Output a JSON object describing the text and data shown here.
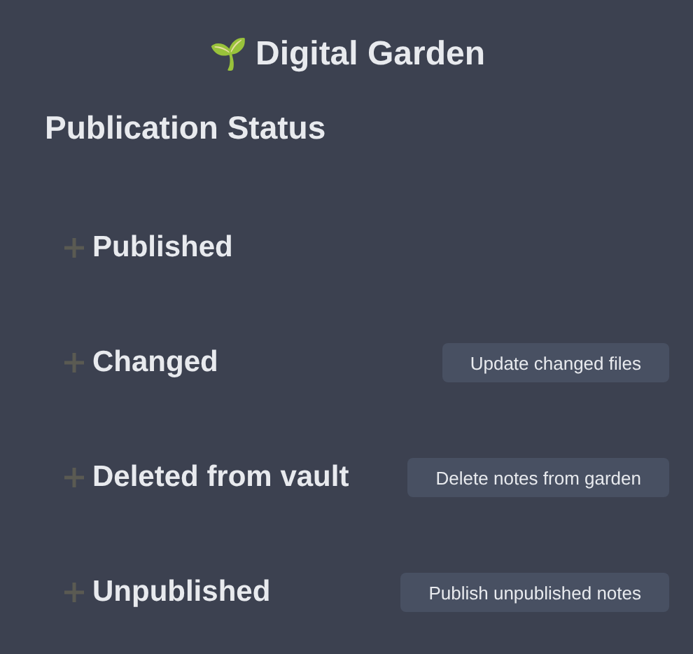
{
  "header": {
    "icon": "🌱",
    "title": "Digital Garden"
  },
  "heading": "Publication Status",
  "sections": [
    {
      "label": "Published"
    },
    {
      "label": "Changed",
      "button": "Update changed files"
    },
    {
      "label": "Deleted from vault",
      "button": "Delete notes from garden"
    },
    {
      "label": "Unpublished",
      "button": "Publish unpublished notes"
    }
  ]
}
